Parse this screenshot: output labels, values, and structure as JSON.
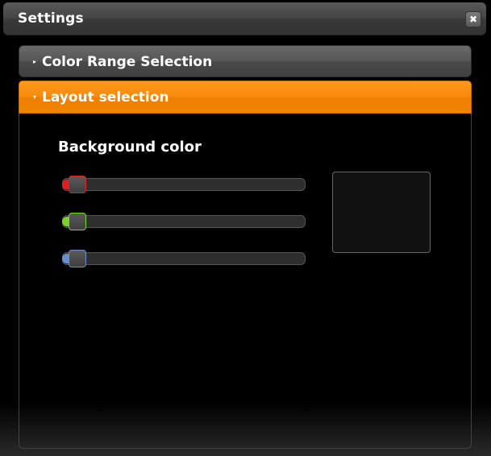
{
  "window": {
    "title": "Settings",
    "close_glyph": "✖"
  },
  "accordion": {
    "sections": [
      {
        "label": "Color Range Selection",
        "arrow": "▸",
        "expanded": false
      },
      {
        "label": "Layout selection",
        "arrow": "▾",
        "expanded": true
      }
    ]
  },
  "layout": {
    "heading": "Background color",
    "sliders": [
      {
        "channel": "red",
        "value": 0,
        "color": "#e02020"
      },
      {
        "channel": "green",
        "value": 0,
        "color": "#7ad12a"
      },
      {
        "channel": "blue",
        "value": 0,
        "color": "#6a8fd0"
      }
    ],
    "preview_color": "#111111"
  },
  "colors": {
    "accent": "#f7890c"
  }
}
